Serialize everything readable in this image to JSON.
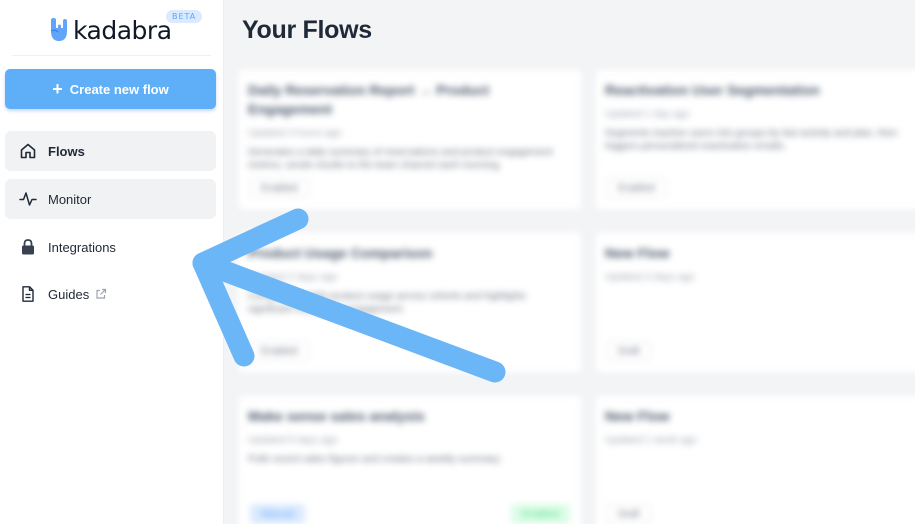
{
  "brand": {
    "name": "kadabra",
    "badge": "BETA"
  },
  "sidebar": {
    "create_label": "Create new flow",
    "items": [
      {
        "label": "Flows",
        "icon": "home-icon",
        "active": true
      },
      {
        "label": "Monitor",
        "icon": "activity-icon"
      },
      {
        "label": "Integrations",
        "icon": "lock-icon"
      },
      {
        "label": "Guides",
        "icon": "document-icon",
        "external": true
      }
    ]
  },
  "main": {
    "title": "Your Flows",
    "cards": [
      {
        "title": "Daily Reservation Report → Product Engagement",
        "subtitle": "Updated 3 hours ago",
        "description": "Generates a daily summary of reservations and product engagement metrics, sends results to the team channel each morning.",
        "tag": "Enabled"
      },
      {
        "title": "Reactivation User Segmentation",
        "subtitle": "Updated 1 day ago",
        "description": "Segments inactive users into groups by last activity and plan, then triggers personalized reactivation emails.",
        "tag": "Enabled"
      },
      {
        "title": "Product Usage Comparison",
        "subtitle": "Updated 2 days ago",
        "description": "Compares weekly product usage across cohorts and highlights significant changes in engagement.",
        "tag": "Enabled"
      },
      {
        "title": "New Flow",
        "subtitle": "Updated 3 days ago",
        "description": "",
        "tag": "Draft"
      },
      {
        "title": "Make sense sales analysis",
        "subtitle": "Updated 5 days ago",
        "description": "Pulls recent sales figures and creates a weekly summary.",
        "tag": "Manual",
        "tag2": "Enabled"
      },
      {
        "title": "New Flow",
        "subtitle": "Updated 1 week ago",
        "description": "",
        "tag": "Draft"
      }
    ]
  },
  "colors": {
    "accent": "#5eaef8",
    "arrow": "#6bb6f6"
  }
}
